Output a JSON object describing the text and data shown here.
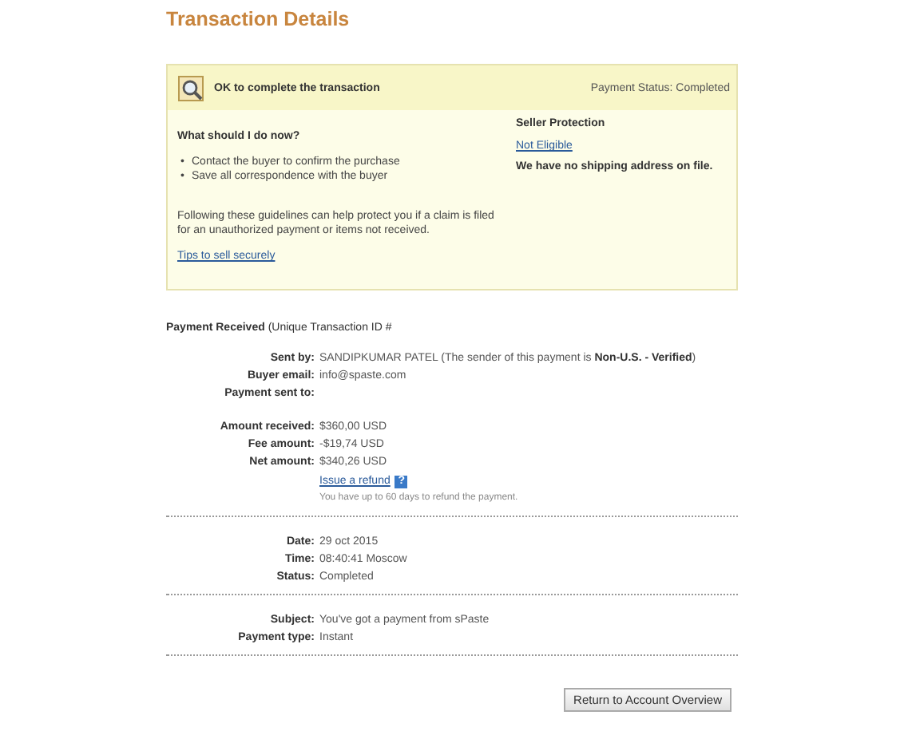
{
  "title": "Transaction Details",
  "notice": {
    "message": "OK to complete the transaction",
    "payment_status": "Payment Status: Completed",
    "heading": "What should I do now?",
    "steps": [
      {
        "bullet": "•",
        "text": "Contact the buyer to confirm the purchase"
      },
      {
        "bullet": "•",
        "text": "Save all correspondence with the buyer"
      }
    ],
    "guidance": "Following these guidelines can help protect you if a claim is filed for an unauthorized payment or items not received.",
    "tips_link": "Tips to sell securely",
    "protection_heading": "Seller Protection",
    "protection_status": "Not Eligible",
    "shipping_note": "We have no shipping address on file."
  },
  "payment_heading": "**Payment Received** (Unique Transaction ID #",
  "sections": [
    {
      "rows": [
        {
          "label": "Sent by:",
          "value": "SANDIPKUMAR PATEL (The sender of this payment is **Non-U.S. - Verified**)"
        },
        {
          "label": "Buyer email:",
          "value": "info@spaste.com"
        },
        {
          "label": "Payment sent to:"
        }
      ]
    },
    {
      "rows": [
        {
          "label": "Amount received:",
          "value": "$360,00 USD"
        },
        {
          "label": "Fee amount:",
          "value": "-$19,74 USD"
        },
        {
          "label": "Net amount:",
          "value": "$340,26 USD"
        }
      ],
      "refund_link": "Issue a refund",
      "help_icon": "?",
      "refund_note": "You have up to 60 days to refund the payment."
    },
    {
      "rows": [
        {
          "label": "Date:",
          "value": "29 oct 2015"
        },
        {
          "label": "Time:",
          "value": "08:40:41 Moscow"
        },
        {
          "label": "Status:",
          "value": "Completed"
        }
      ]
    },
    {
      "rows": [
        {
          "label": "Subject:",
          "value": "You've got a payment from sPaste"
        },
        {
          "label": "Payment type:",
          "value": "Instant"
        }
      ]
    }
  ],
  "return_button": "Return to Account Overview"
}
